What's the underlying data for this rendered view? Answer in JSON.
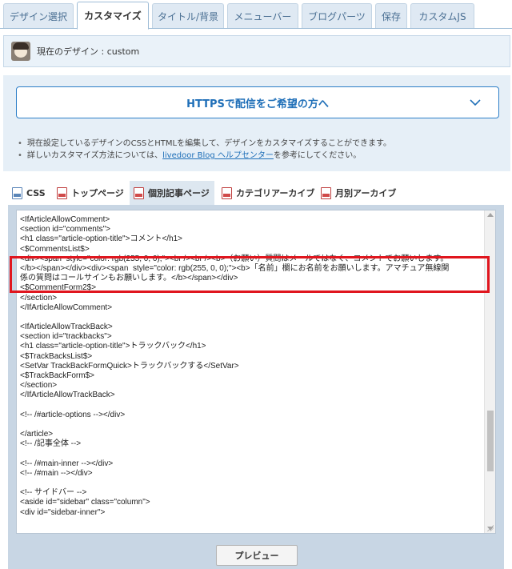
{
  "top_tabs": [
    {
      "label": "デザイン選択"
    },
    {
      "label": "カスタマイズ"
    },
    {
      "label": "タイトル/背景"
    },
    {
      "label": "メニューバー"
    },
    {
      "label": "ブログパーツ"
    },
    {
      "label": "保存"
    },
    {
      "label": "カスタムJS"
    }
  ],
  "active_top_tab": "カスタマイズ",
  "current_design": {
    "label": "現在のデザイン : custom"
  },
  "https_banner": {
    "label": "HTTPSで配信をご希望の方へ"
  },
  "info": {
    "line1": "現在設定しているデザインのCSSとHTMLを編集して、デザインをカスタマイズすることができます。",
    "line2_prefix": "詳しいカスタマイズ方法については、",
    "line2_link": "livedoor Blog ヘルプセンター",
    "line2_suffix": "を参考にしてください。"
  },
  "file_tabs": [
    {
      "label": "CSS",
      "icon": "css-file-icon"
    },
    {
      "label": "トップページ",
      "icon": "html-file-icon"
    },
    {
      "label": "個別記事ページ",
      "icon": "html-file-icon"
    },
    {
      "label": "カテゴリアーカイブ",
      "icon": "html-file-icon"
    },
    {
      "label": "月別アーカイブ",
      "icon": "html-file-icon"
    }
  ],
  "active_file_tab": "個別記事ページ",
  "code_lines": [
    "<IfArticleAllowComment>",
    "<section id=\"comments\">",
    "<h1 class=\"article-option-title\">コメント</h1>",
    "<$CommentsList$>",
    "<div><span  style=\"color: rgb(255, 0, 0);\"><br /><br /><b>（お願い）質問はメールではなく、コメントでお願いします。",
    "</b></span></div><div><span  style=\"color: rgb(255, 0, 0);\"><b>「名前」欄にお名前をお願いします。アマチュア無線関",
    "係の質問はコールサインもお願いします。</b></span></div>",
    "<$CommentForm2$>",
    "</section>",
    "</IfArticleAllowComment>",
    "",
    "<IfArticleAllowTrackBack>",
    "<section id=\"trackbacks\">",
    "<h1 class=\"article-option-title\">トラックバック</h1>",
    "<$TrackBacksList$>",
    "<SetVar TrackBackFormQuick>トラックバックする</SetVar>",
    "<$TrackBackForm$>",
    "</section>",
    "</IfArticleAllowTrackBack>",
    "",
    "<!-- /#article-options --></div>",
    "",
    "</article>",
    "<!-- /記事全体 -->",
    "",
    "<!-- /#main-inner --></div>",
    "<!-- /#main --></div>",
    "",
    "<!-- サイドバー -->",
    "<aside id=\"sidebar\" class=\"column\">",
    "<div id=\"sidebar-inner\">"
  ],
  "preview_button": {
    "label": "プレビュー"
  },
  "colors": {
    "highlight": "#e0161e",
    "accent": "#1f6fb8"
  }
}
